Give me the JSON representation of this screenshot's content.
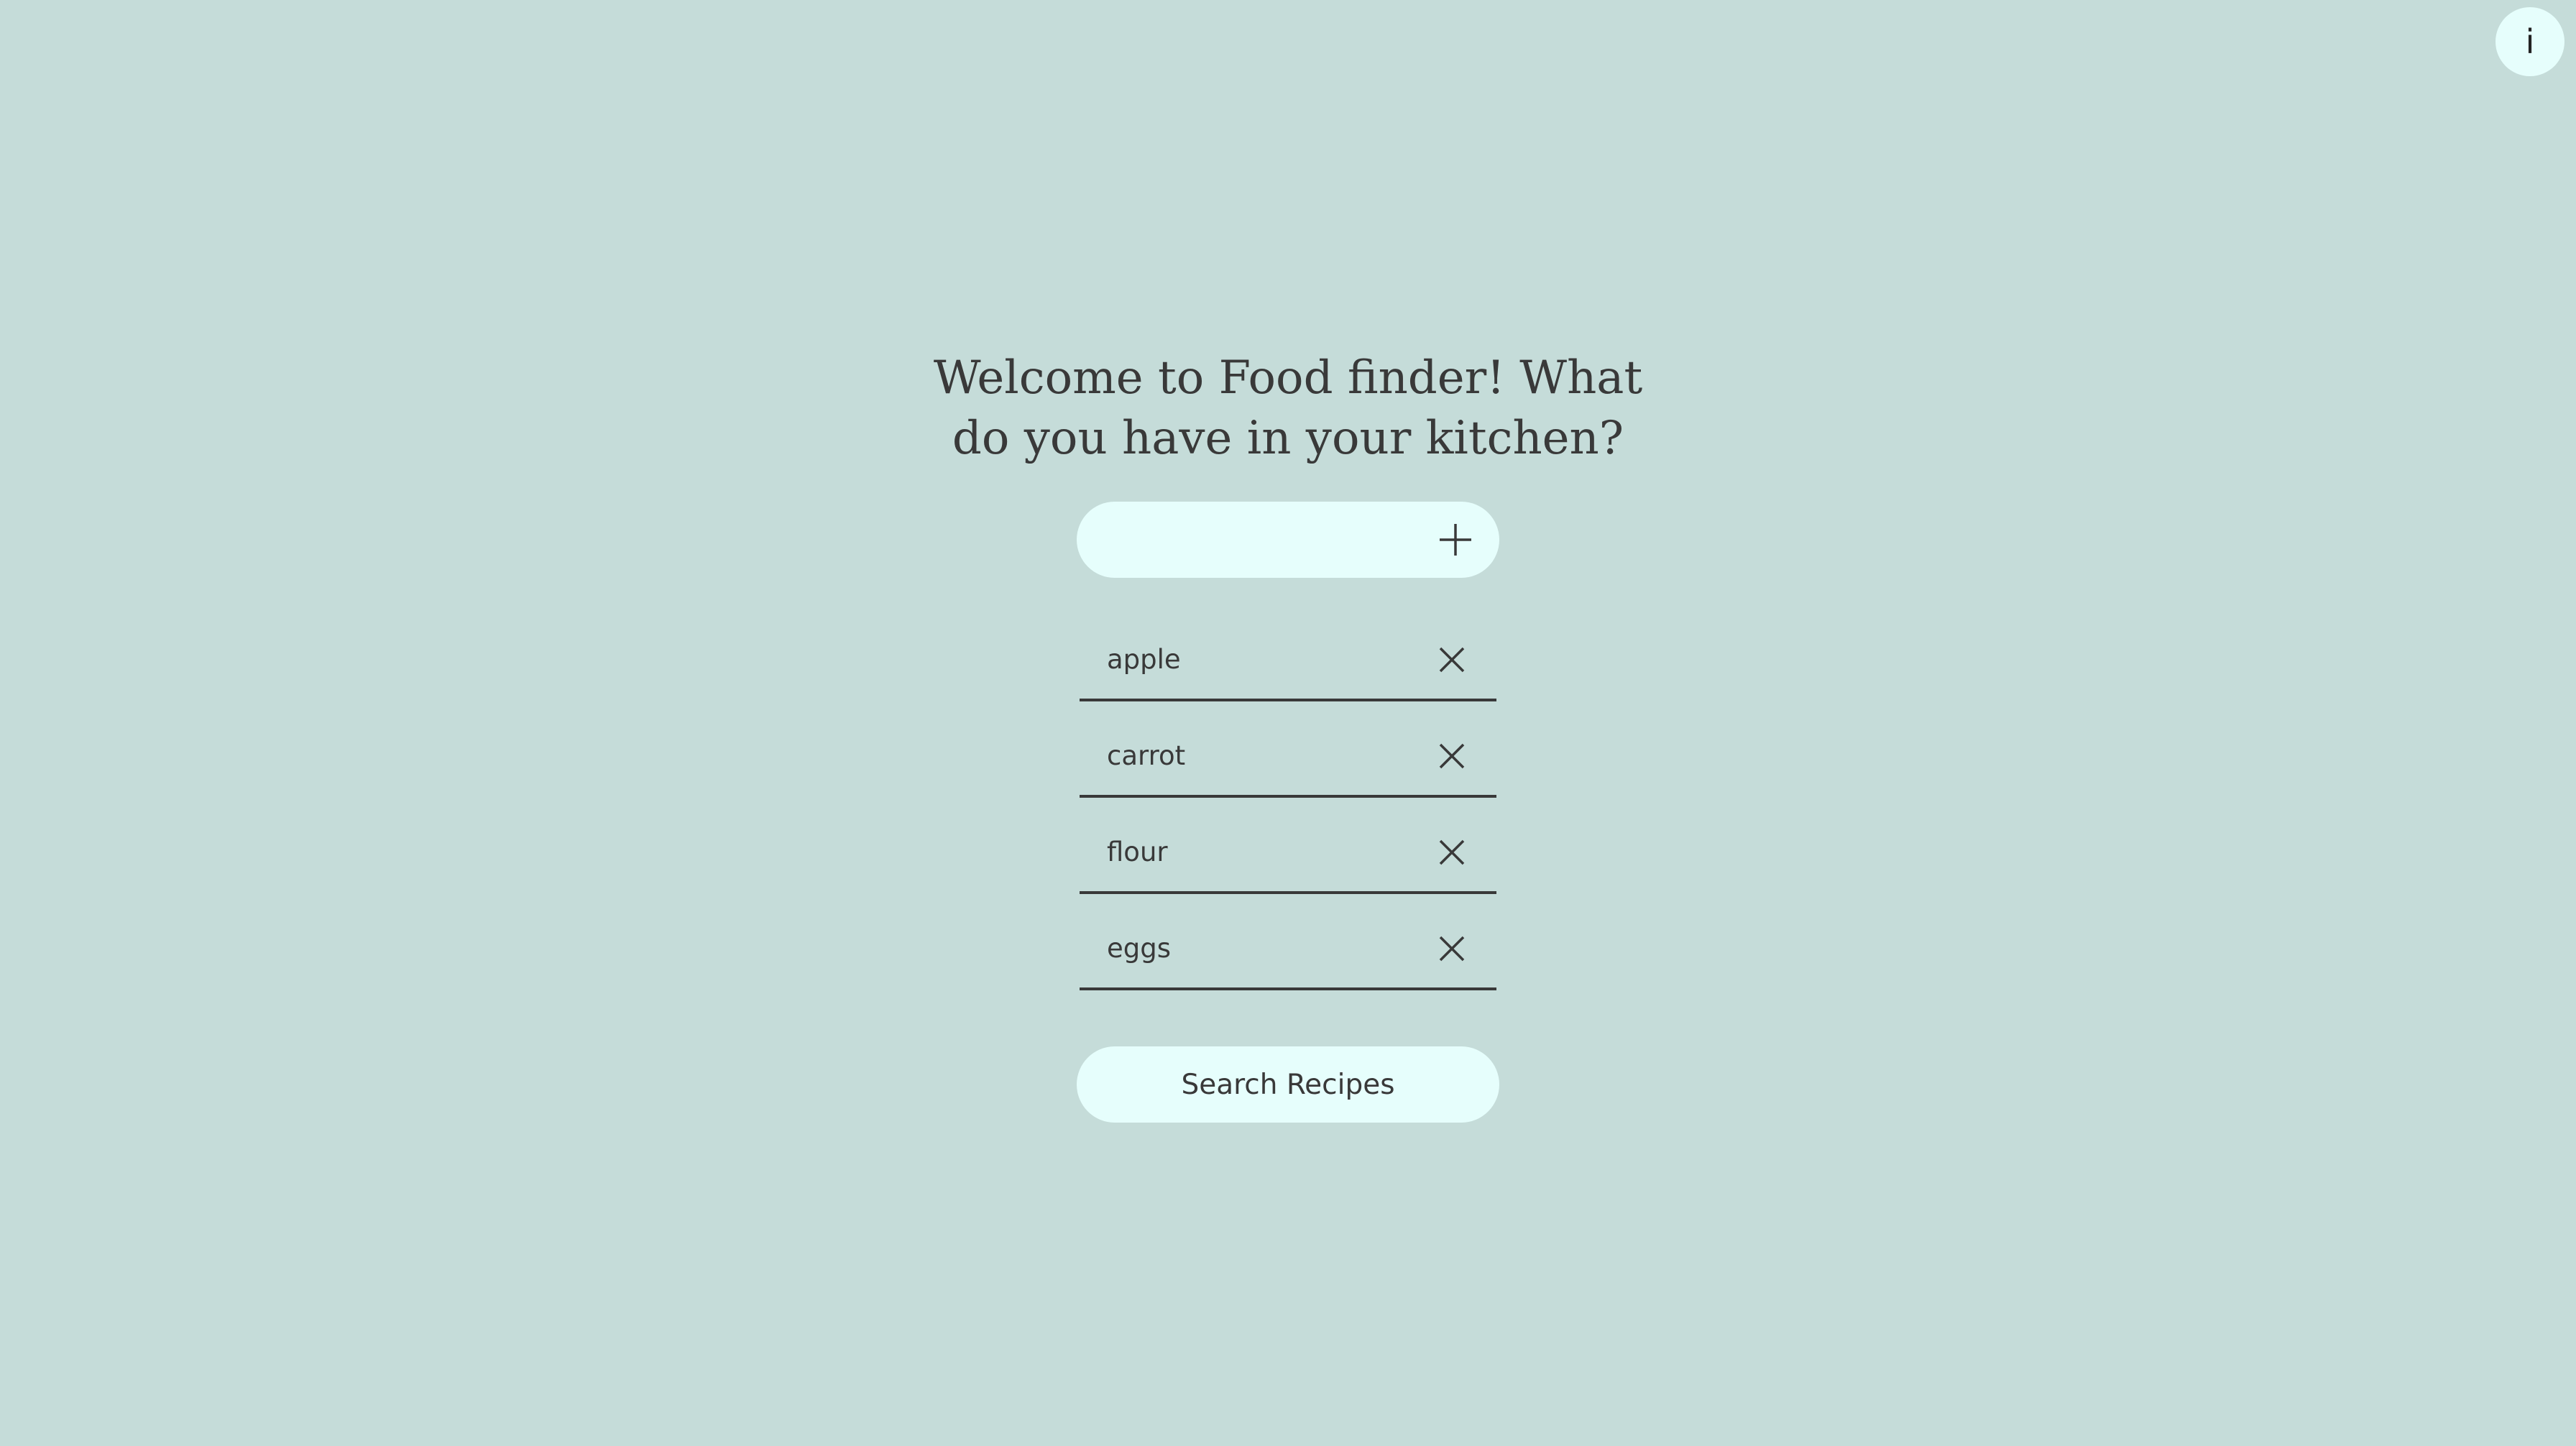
{
  "info_button": {
    "label": "i"
  },
  "heading": {
    "text": "Welcome to Food finder! What do you have in your kitchen?"
  },
  "add_ingredient": {
    "value": "",
    "placeholder": "",
    "icon": "plus-icon"
  },
  "ingredients": [
    {
      "name": "apple",
      "remove_icon": "close-icon"
    },
    {
      "name": "carrot",
      "remove_icon": "close-icon"
    },
    {
      "name": "flour",
      "remove_icon": "close-icon"
    },
    {
      "name": "eggs",
      "remove_icon": "close-icon"
    }
  ],
  "search_button": {
    "label": "Search Recipes"
  },
  "colors": {
    "background": "#c5dcd9",
    "surface": "#e6fefc",
    "text": "#393939"
  }
}
